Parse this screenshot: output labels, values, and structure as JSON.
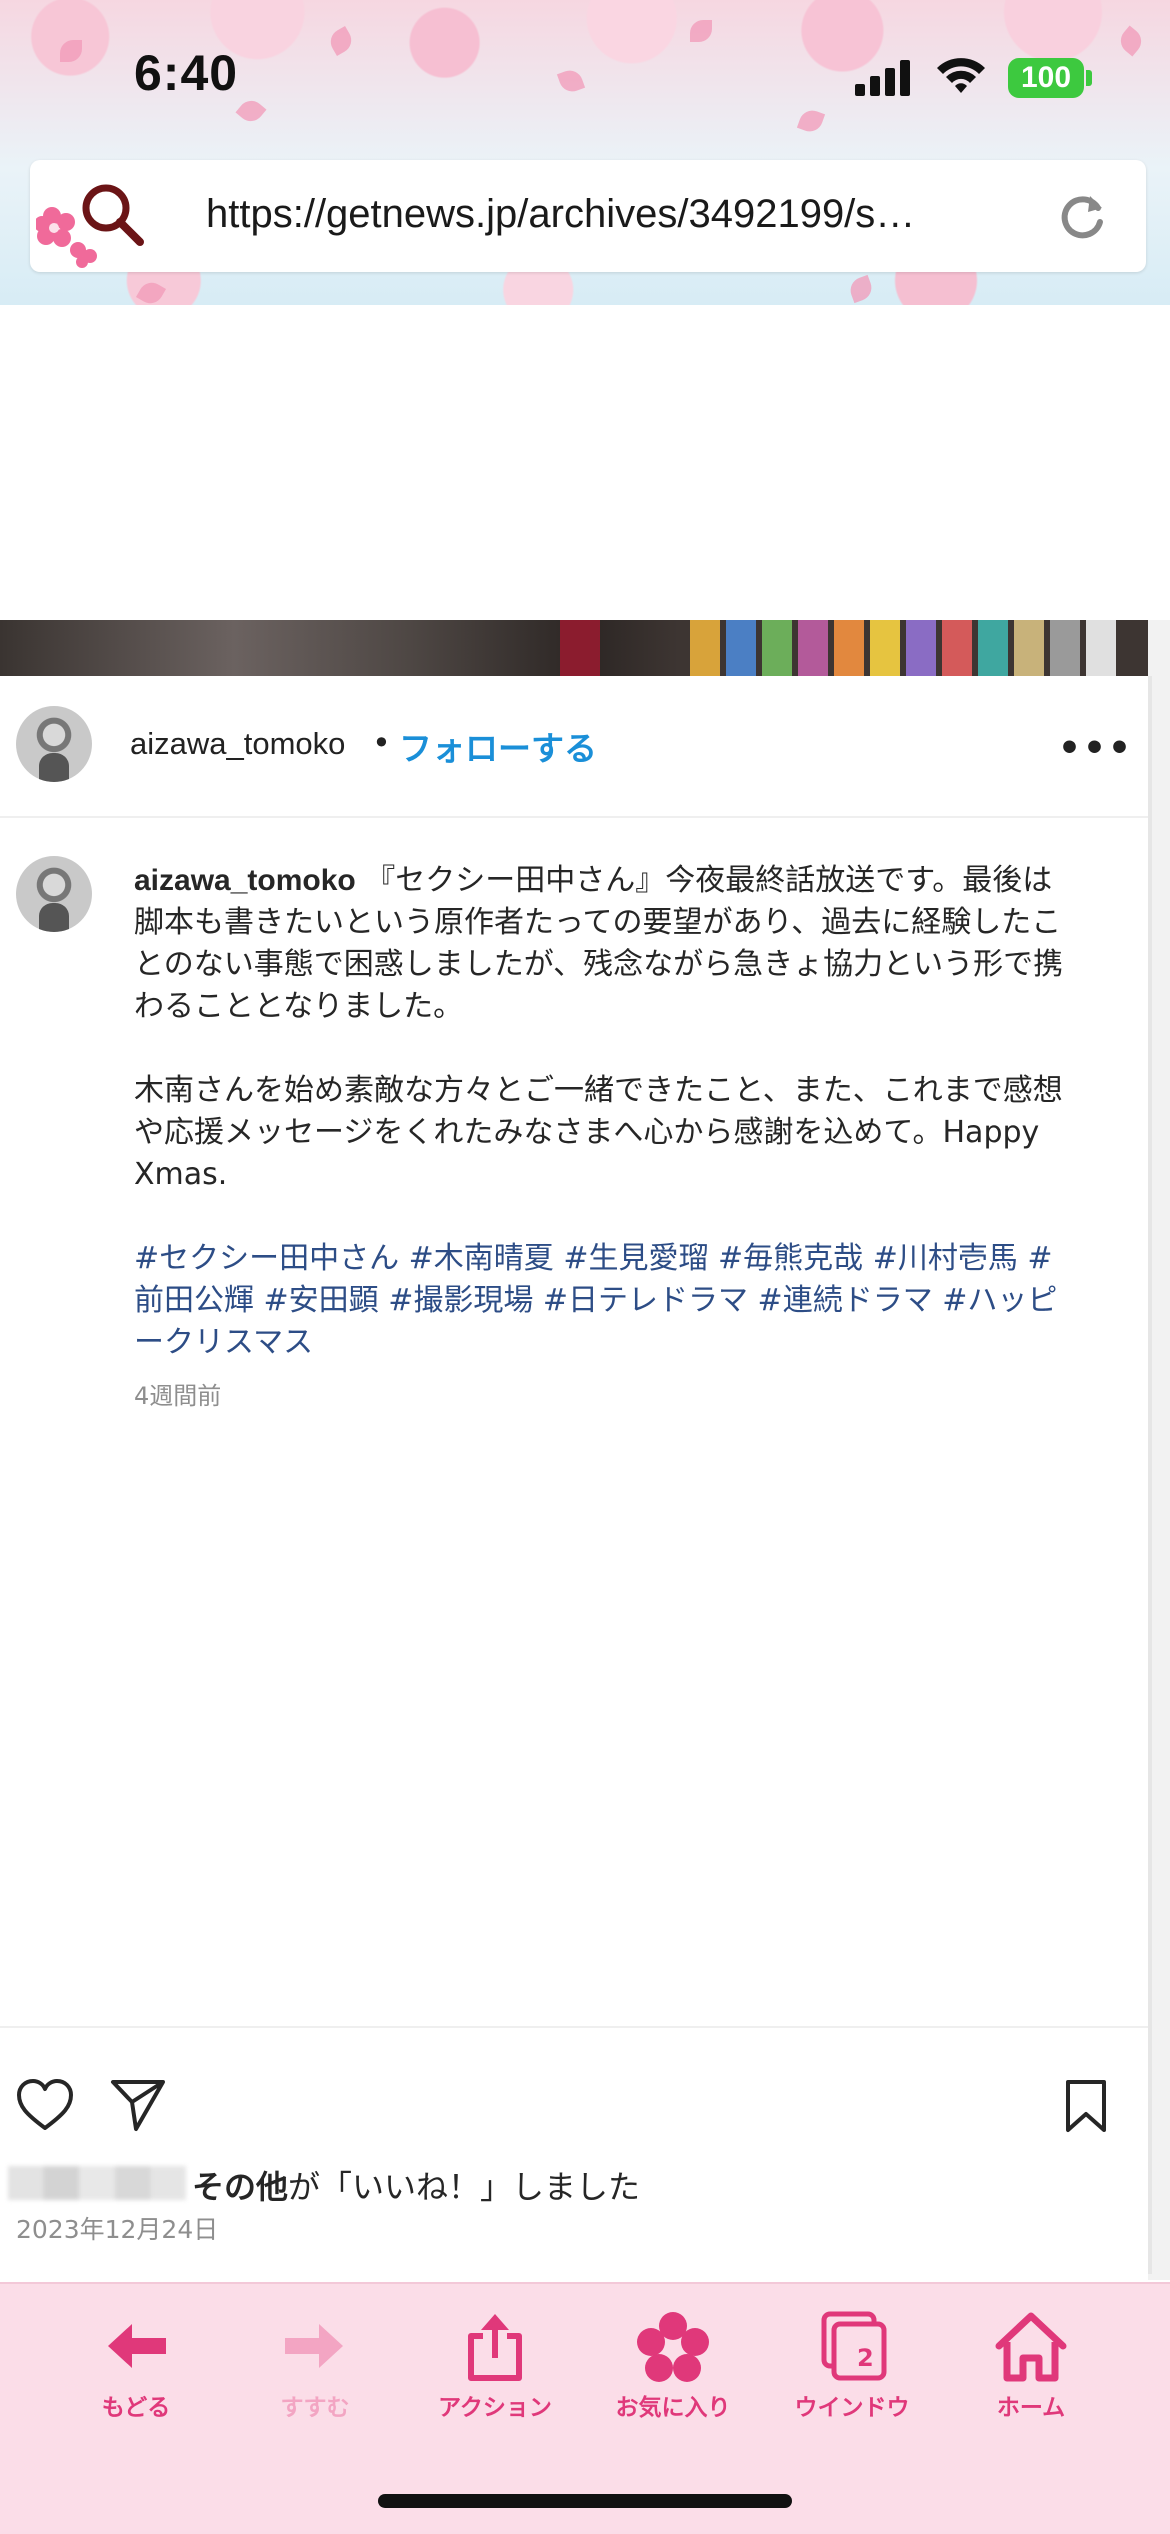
{
  "status_bar": {
    "time": "6:40",
    "battery": "100"
  },
  "browser": {
    "url": "https://getnews.jp/archives/3492199/s…"
  },
  "post": {
    "username": "aizawa_tomoko",
    "separator": "•",
    "follow_label": "フォローする",
    "more_label": "•••",
    "caption_user": "aizawa_tomoko",
    "caption_para1": "『セクシー田中さん』今夜最終話放送です。最後は脚本も書きたいという原作者たっての要望があり、過去に経験したことのない事態で困惑しましたが、残念ながら急きょ協力という形で携わることとなりました。",
    "caption_para2": "木南さんを始め素敵な方々とご一緒できたこと、また、これまで感想や応援メッセージをくれたみなさまへ心から感謝を込めて。Happy Xmas.",
    "hashtags": "#セクシー田中さん #木南晴夏 #生見愛瑠 #毎熊克哉 #川村壱馬 #前田公輝 #安田顕 #撮影現場 #日テレドラマ #連続ドラマ #ハッピークリスマス",
    "time_ago": "4週間前",
    "likes_bold": "その他",
    "likes_rest": "が「いいね！」しました",
    "date": "2023年12月24日"
  },
  "toolbar": {
    "back_label": "もどる",
    "forward_label": "すすむ",
    "action_label": "アクション",
    "favorites_label": "お気に入り",
    "windows_label": "ウインドウ",
    "windows_count": "2",
    "home_label": "ホーム"
  },
  "colors": {
    "accent": "#e0387a",
    "accent_disabled": "#f3a5c3",
    "toolbar_bg": "#fbdde8",
    "follow_blue": "#1a8fd8",
    "hashtag": "#2d4d86",
    "battery_green": "#3dc93f"
  },
  "icons": {
    "url_bar": [
      "sakura-icon",
      "search-icon",
      "reload-icon"
    ],
    "post": [
      "heart-icon",
      "send-icon",
      "bookmark-icon"
    ],
    "toolbar": [
      "arrow-left-icon",
      "arrow-right-icon",
      "share-icon",
      "sakura-icon",
      "windows-icon",
      "home-icon"
    ]
  }
}
